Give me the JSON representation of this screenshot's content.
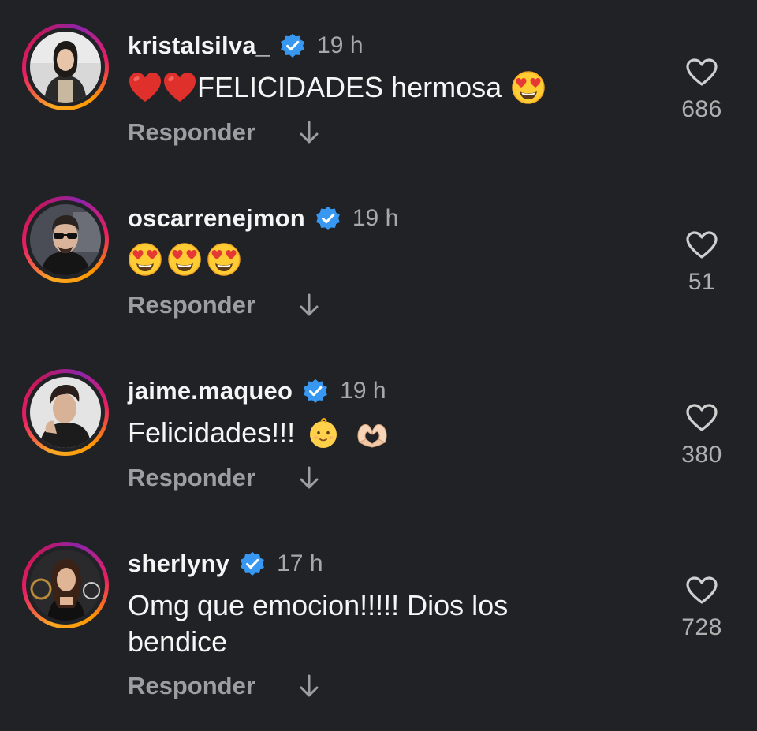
{
  "reply_label": "Responder",
  "comments": [
    {
      "username": "kristalsilva_",
      "verified": true,
      "time": "19 h",
      "text_prefix": "",
      "text": "FELICIDADES hermosa",
      "emojis_before": [
        "red-heart",
        "red-heart"
      ],
      "emojis_after": [
        "heart-eyes"
      ],
      "likes": "686"
    },
    {
      "username": "oscarrenejmon",
      "verified": true,
      "time": "19 h",
      "text": "",
      "emojis_after": [
        "heart-eyes",
        "heart-eyes",
        "heart-eyes"
      ],
      "likes": "51"
    },
    {
      "username": "jaime.maqueo",
      "verified": true,
      "time": "19 h",
      "text": "Felicidades!!!",
      "emojis_after": [
        "baby",
        "heart-hands"
      ],
      "likes": "380"
    },
    {
      "username": "sherlyny",
      "verified": true,
      "time": "17 h",
      "text_line1": "Omg que emocion!!!!! Dios los",
      "text_line2": "bendice",
      "likes": "728"
    }
  ],
  "colors": {
    "background": "#202226",
    "verified_badge": "#3897f0",
    "muted": "#9b9ea3"
  }
}
